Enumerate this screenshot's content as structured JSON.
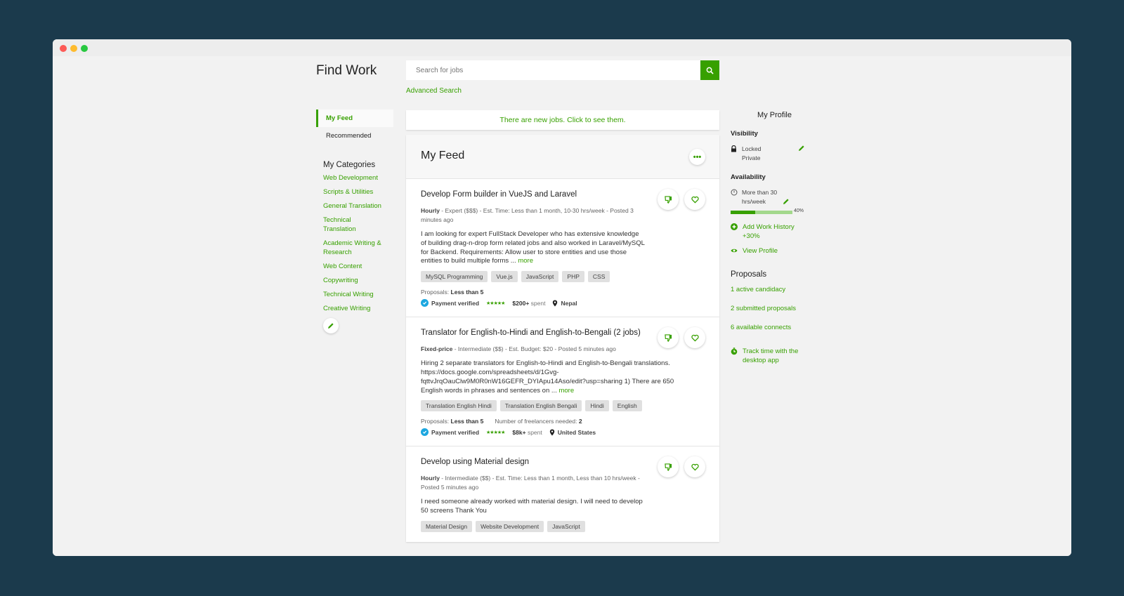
{
  "window": {
    "controls": [
      "close",
      "minimize",
      "maximize"
    ]
  },
  "header": {
    "title": "Find Work",
    "search": {
      "placeholder": "Search for jobs",
      "value": "",
      "icon": "search-icon"
    },
    "advanced_search": "Advanced Search"
  },
  "leftnav": {
    "items": [
      {
        "label": "My Feed",
        "active": true
      },
      {
        "label": "Recommended",
        "active": false
      }
    ],
    "categories_title": "My Categories",
    "categories": [
      "Web Development",
      "Scripts & Utilities",
      "General Translation",
      "Technical Translation",
      "Academic Writing & Research",
      "Web Content",
      "Copywriting",
      "Technical Writing",
      "Creative Writing"
    ],
    "edit_icon": "pencil-icon"
  },
  "banner": "There are new jobs. Click to see them.",
  "feed": {
    "title": "My Feed",
    "more_icon": "ellipsis-icon",
    "jobs": [
      {
        "title": "Develop Form builder in VueJS and Laravel",
        "type": "Hourly",
        "meta": " - Expert ($$$) - Est. Time: Less than 1 month, 10-30 hrs/week - Posted 3 minutes ago",
        "description": "I am looking for expert FullStack Developer who has extensive knowledge of building drag-n-drop form related jobs and also worked in Laravel/MySQL for Backend. Requirements: Allow user to store entities and use those entities to build multiple forms ...",
        "more": "more",
        "tags": [
          "MySQL Programming",
          "Vue.js",
          "JavaScript",
          "PHP",
          "CSS"
        ],
        "proposals_label": "Proposals: ",
        "proposals_value": "Less than 5",
        "freelancers_label": "",
        "freelancers_value": "",
        "payment": "Payment verified",
        "rating": 4.5,
        "stars": "★★★★★",
        "spent_amount": "$200+",
        "spent_label": " spent",
        "location": "Nepal"
      },
      {
        "title": "Translator for English-to-Hindi and English-to-Bengali (2 jobs)",
        "type": "Fixed-price",
        "meta": " - Intermediate ($$) - Est. Budget: $20 - Posted 5 minutes ago",
        "description": "Hiring 2 separate translators for English-to-Hindi and English-to-Bengali translations. https://docs.google.com/spreadsheets/d/1Gvg-fqttvJrqOauClw9M0R0nW16GEFR_DYIApu14Aso/edit?usp=sharing 1) There are 650 English words in phrases and sentences on ...",
        "more": "more",
        "tags": [
          "Translation English Hindi",
          "Translation English Bengali",
          "Hindi",
          "English"
        ],
        "proposals_label": "Proposals: ",
        "proposals_value": "Less than 5",
        "freelancers_label": "Number of freelancers needed: ",
        "freelancers_value": "2",
        "payment": "Payment verified",
        "rating": 5,
        "stars": "★★★★★",
        "spent_amount": "$8k+",
        "spent_label": " spent",
        "location": "United States"
      },
      {
        "title": "Develop using Material design",
        "type": "Hourly",
        "meta": " - Intermediate ($$) - Est. Time: Less than 1 month, Less than 10 hrs/week - Posted 5 minutes ago",
        "description": "I need someone already worked with material design. I will need to develop 50 screens Thank You",
        "more": "",
        "tags": [
          "Material Design",
          "Website Development",
          "JavaScript"
        ]
      }
    ]
  },
  "profile": {
    "title": "My Profile",
    "visibility_label": "Visibility",
    "visibility_value": "Locked Private",
    "availability_label": "Availability",
    "availability_value": "More than 30 hrs/week",
    "completeness_percent": 40,
    "completeness_text": "40%",
    "add_work_history": "Add Work History +30%",
    "view_profile": "View Profile"
  },
  "proposals": {
    "title": "Proposals",
    "links": [
      "1 active candidacy",
      "2 submitted proposals",
      "6 available connects"
    ],
    "track_time": "Track time with the desktop app"
  },
  "colors": {
    "accent": "#37a000",
    "verified": "#1ca7e0",
    "background": "#1b3a4c"
  }
}
